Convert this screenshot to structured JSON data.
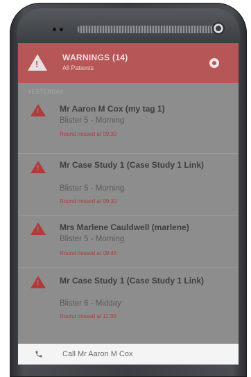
{
  "header": {
    "title": "WARNINGS (14)",
    "subtitle": "All Patients"
  },
  "section": {
    "label": "YESTERDAY"
  },
  "warnings": [
    {
      "name": "Mr Aaron M Cox (my tag 1)",
      "sub": "Blister 5 - Morning",
      "alert": "Round missed at 09:30"
    },
    {
      "name": "Mr Case Study 1 (Case Study 1 Link)",
      "sub": "Blister 5 - Morning",
      "alert": "Round missed at 09:30"
    },
    {
      "name": "Mrs Marlene Cauldwell (marlene)",
      "sub": "Blister 5 - Morning",
      "alert": "Round missed at 09:45"
    },
    {
      "name": "Mr Case Study 1 (Case Study 1 Link)",
      "sub": "Blister 6 - Midday",
      "alert": "Round missed at 11:30"
    }
  ],
  "footer": {
    "call_label": "Call Mr Aaron M Cox"
  },
  "colors": {
    "header_bg": "#b75656",
    "warning_icon": "#b43a3a",
    "alert_text": "#b33a3a"
  },
  "icons": {
    "header": "warning-triangle-icon",
    "header_action": "eye-icon",
    "item": "warning-triangle-icon",
    "footer": "phone-icon"
  }
}
